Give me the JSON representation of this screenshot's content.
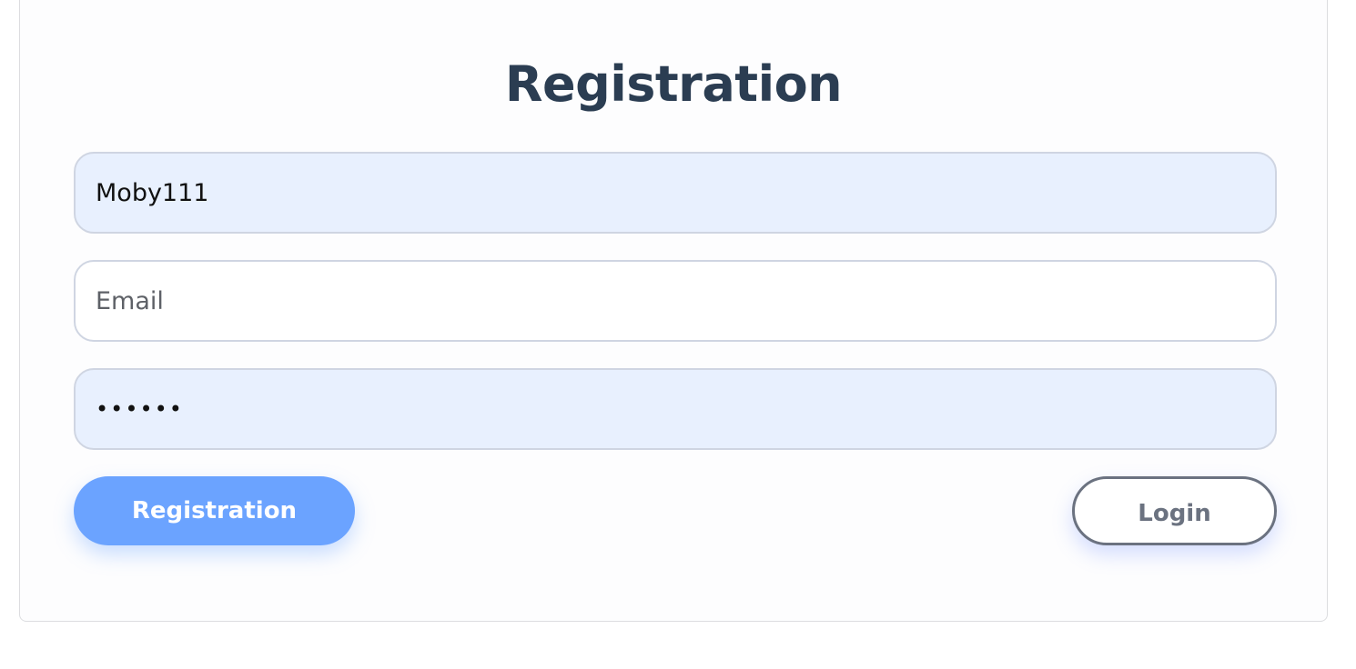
{
  "form": {
    "title": "Registration",
    "username": {
      "value": "Moby111"
    },
    "email": {
      "value": "",
      "placeholder": "Email"
    },
    "password": {
      "value": "123456"
    },
    "register_button_label": "Registration",
    "login_button_label": "Login"
  },
  "colors": {
    "title": "#2b3d52",
    "primary_button": "#6ba3ff",
    "autofill_background": "#e8f0fe",
    "secondary_button_border": "#6b7280"
  }
}
